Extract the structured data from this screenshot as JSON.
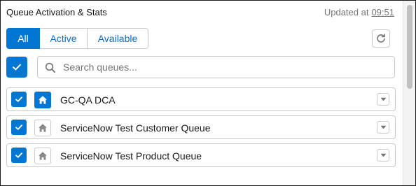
{
  "header": {
    "title": "Queue Activation & Stats",
    "updated_label": "Updated at",
    "updated_time": "09:51"
  },
  "tabs": [
    {
      "label": "All",
      "selected": true
    },
    {
      "label": "Active",
      "selected": false
    },
    {
      "label": "Available",
      "selected": false
    }
  ],
  "toolbar": {
    "refresh_icon": "refresh-icon"
  },
  "select_all": {
    "checked": true
  },
  "search": {
    "placeholder": "Search queues...",
    "value": ""
  },
  "queues": [
    {
      "name": "GC-QA DCA",
      "checked": true,
      "home_active": true
    },
    {
      "name": "ServiceNow Test Customer Queue",
      "checked": true,
      "home_active": false
    },
    {
      "name": "ServiceNow Test Product Queue",
      "checked": true,
      "home_active": false
    }
  ],
  "colors": {
    "brand": "#0176d3",
    "border": "#c9c9c9",
    "muted_text": "#747474",
    "link": "#0b6bcb"
  }
}
